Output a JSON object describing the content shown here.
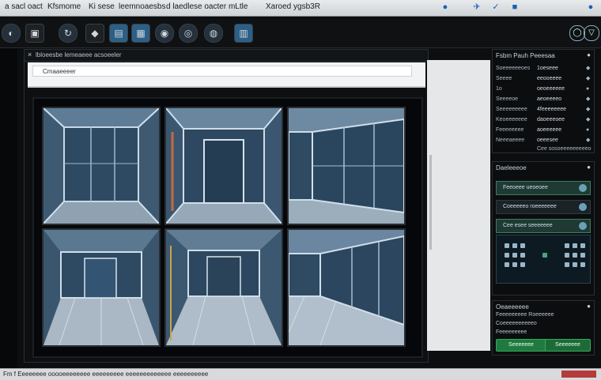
{
  "menubar": {
    "items": [
      "a sacl oact",
      "Kfsmome",
      "Ki sese",
      "leemnoaesbs",
      "d laedlese oacter mLtle",
      "Xaroed ygsb3R"
    ],
    "controls": [
      "●",
      "✈",
      "✓",
      "■",
      "●"
    ]
  },
  "toolbar": {
    "buttons": [
      "◐",
      "▣",
      "↻",
      "◆",
      "▤",
      "▦",
      "◉",
      "◎",
      "◍",
      "▥"
    ],
    "right": [
      "◯",
      "▽"
    ]
  },
  "document": {
    "title": "lbloeesbe lemeaeee acsoeeler",
    "close": "×",
    "address": "Cmaaeeeer",
    "views": [
      {
        "name": "top-left"
      },
      {
        "name": "top-middle"
      },
      {
        "name": "top-right"
      },
      {
        "name": "bottom-left"
      },
      {
        "name": "bottom-middle"
      },
      {
        "name": "bottom-right"
      }
    ]
  },
  "properties": {
    "title": "Fsbm Pauh Peeesaa",
    "close": "●",
    "rows": [
      {
        "label": "Soeeeeeeoes",
        "value": "1oeseee",
        "icon": "◆"
      },
      {
        "label": "Seeee",
        "value": "eeooeeee",
        "icon": "◆"
      },
      {
        "label": "1o",
        "value": "oeoeeeeee",
        "icon": "●"
      },
      {
        "label": "Seeeeoe",
        "value": "aeoeeeeo",
        "icon": "◆"
      },
      {
        "label": "Seeeeeeeee",
        "value": "4feeeeeeee",
        "icon": "◆"
      },
      {
        "label": "Keoeeeeeee",
        "value": "daoeeeoee",
        "icon": "◆"
      },
      {
        "label": "Feeeeeeee",
        "value": "aoeeeeee",
        "icon": "●"
      },
      {
        "label": "Neeeaeeee",
        "value": "oeeesee",
        "icon": "◆"
      }
    ],
    "footer": "Cee sosoeeeeeeeeeo"
  },
  "layers": {
    "title": "Daeleeeoe",
    "close": "●",
    "rows": [
      {
        "text": "Feeoeee ueoeoee",
        "active": true
      },
      {
        "text": "Coeeeeeo roeeeeeee",
        "active": false
      },
      {
        "text": "Cee esee seeeeeee",
        "active": true
      }
    ]
  },
  "settings": {
    "title": "Oeaeeeeee",
    "close": "●",
    "items": [
      "Feeeeeeeee Roeeeeee",
      "Coeeeeeeeeeeo",
      "Feeeeeeeee"
    ],
    "ok": "Seeeeeee",
    "cancel": "Seeeeeee"
  },
  "status": {
    "text": "Fm f Eeeeeeee  ooooeeeeeeee eeeeeeeee eeeeeeeeeeeee eeeeeeeeee"
  }
}
